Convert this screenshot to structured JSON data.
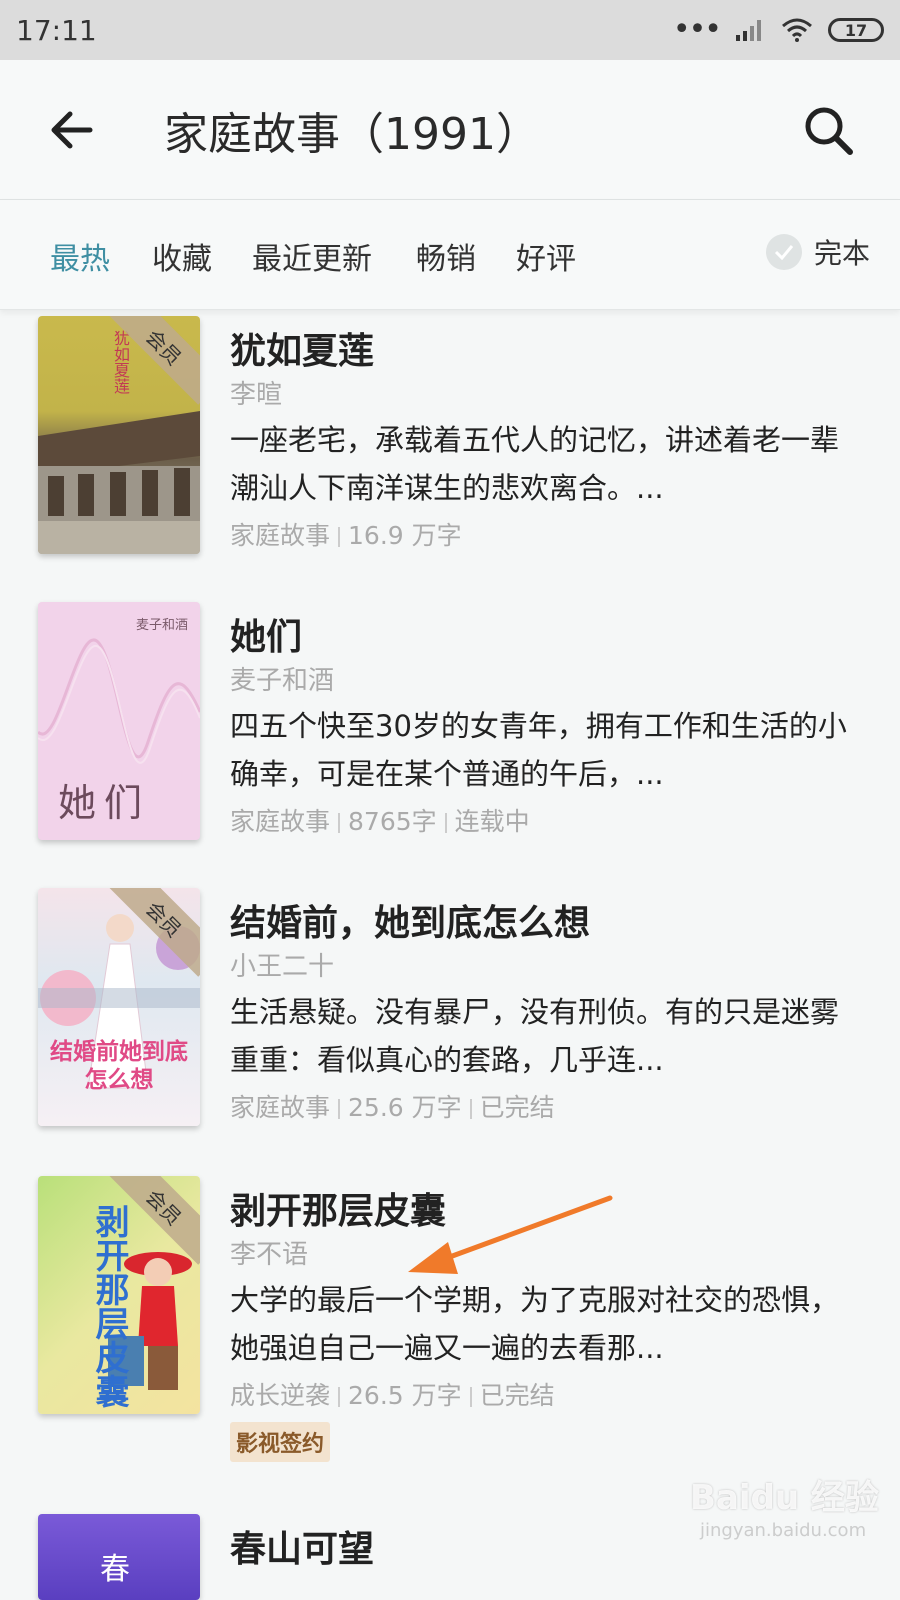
{
  "status": {
    "time": "17:11",
    "battery": "17"
  },
  "header": {
    "title": "家庭故事（1991）"
  },
  "filters": {
    "tabs": [
      {
        "label": "最热"
      },
      {
        "label": "收藏"
      },
      {
        "label": "最近更新"
      },
      {
        "label": "畅销"
      },
      {
        "label": "好评"
      }
    ],
    "active_tab": "最热",
    "complete_label": "完本"
  },
  "books": [
    {
      "title": "犹如夏莲",
      "author": "李暄",
      "description": "一座老宅，承载着五代人的记忆，讲述着老一辈潮汕人下南洋谋生的悲欢离合。...",
      "category": "家庭故事",
      "words": "16.9 万字",
      "status": "",
      "badge": "会员",
      "cover_text": "犹如夏莲"
    },
    {
      "title": "她们",
      "author": "麦子和酒",
      "description": "四五个快至30岁的女青年，拥有工作和生活的小确幸，可是在某个普通的午后，...",
      "category": "家庭故事",
      "words": "8765字",
      "status": "连载中",
      "badge": "",
      "cover_text": "她们",
      "cover_author": "麦子和酒"
    },
    {
      "title": "结婚前，她到底怎么想",
      "author": "小王二十",
      "description": "生活悬疑。没有暴尸，没有刑侦。有的只是迷雾重重：看似真心的套路，几乎连...",
      "category": "家庭故事",
      "words": "25.6 万字",
      "status": "已完结",
      "badge": "会员",
      "cover_text": "结婚前她到底怎么想"
    },
    {
      "title": "剥开那层皮囊",
      "author": "李不语",
      "description": "大学的最后一个学期，为了克服对社交的恐惧，她强迫自己一遍又一遍的去看那...",
      "category": "成长逆袭",
      "words": "26.5 万字",
      "status": "已完结",
      "badge": "会员",
      "tag": "影视签约",
      "cover_text": "剥开那层皮囊"
    },
    {
      "title": "春山可望",
      "cover_text": "春"
    }
  ],
  "watermark": {
    "brand": "Baidu 经验",
    "sub": "jingyan.baidu.com"
  },
  "colors": {
    "accent": "#3f8fa3",
    "annotation_arrow": "#f07a2a"
  }
}
